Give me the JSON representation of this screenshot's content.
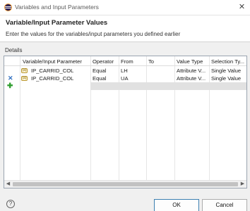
{
  "window": {
    "title": "Variables and Input Parameters"
  },
  "header": {
    "title": "Variable/Input Parameter Values",
    "description": "Enter the values for the variables/input parameters you defined earlier"
  },
  "details": {
    "label": "Details"
  },
  "table": {
    "columns": [
      "Variable/Input Parameter",
      "Operator",
      "From",
      "To",
      "Value Type",
      "Selection Ty..."
    ],
    "rows": [
      {
        "parameter": "IP_CARRID_COL",
        "operator": "Equal",
        "from": "LH",
        "to": "",
        "value_type": "Attribute V...",
        "selection_type": "Single Value"
      },
      {
        "parameter": "IP_CARRID_COL",
        "operator": "Equal",
        "from": "UA",
        "to": "",
        "value_type": "Attribute V...",
        "selection_type": "Single Value"
      }
    ],
    "delete_glyph": "✕",
    "add_glyph": "✚",
    "lock_glyph": "(a)"
  },
  "footer": {
    "ok_label": "OK",
    "cancel_label": "Cancel",
    "help_glyph": "?"
  },
  "icons": {
    "app": "eclipse-icon",
    "close": "close-icon",
    "help": "help-icon",
    "delete": "delete-icon",
    "add": "add-icon",
    "parameter": "parameter-icon"
  },
  "colors": {
    "accent": "#3c7fb1",
    "delete": "#2f6fc1",
    "add": "#2f9e2f"
  }
}
